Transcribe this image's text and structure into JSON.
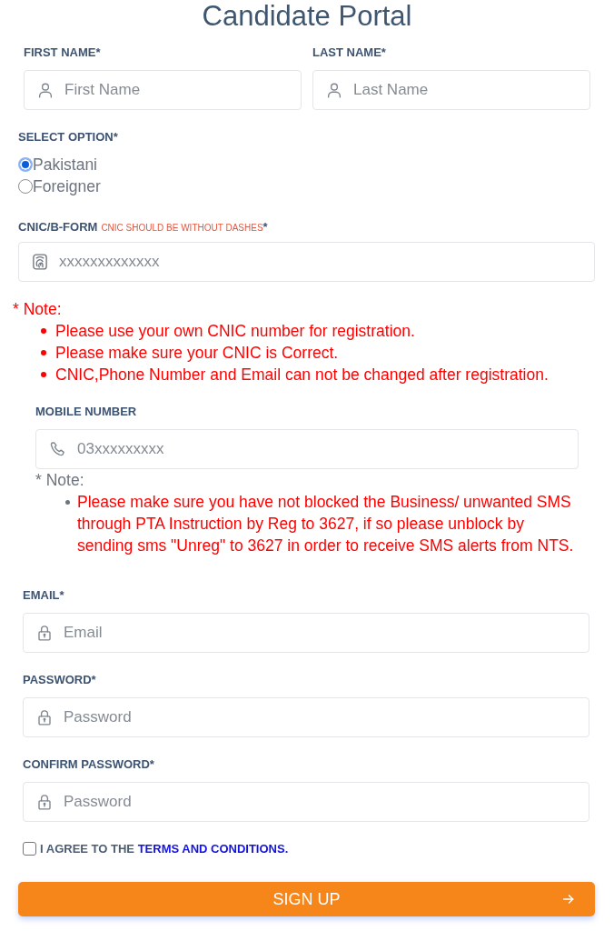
{
  "title": "Candidate Portal",
  "name_fields": [
    {
      "label": "FIRST NAME*",
      "placeholder": "First Name"
    },
    {
      "label": "LAST NAME*",
      "placeholder": "Last Name"
    }
  ],
  "select_option": {
    "label": "SELECT OPTION*",
    "options": [
      {
        "label": "Pakistani",
        "selected": true
      },
      {
        "label": "Foreigner",
        "selected": false
      }
    ]
  },
  "cnic": {
    "label": "CNIC/B-FORM",
    "hint": "CNIC SHOULD BE WITHOUT DASHES",
    "required_mark": "*",
    "placeholder": "xxxxxxxxxxxxx"
  },
  "cnic_note": {
    "heading": "* Note:",
    "items": [
      "Please use your own CNIC number for registration.",
      "Please make sure your CNIC is Correct.",
      "CNIC,Phone Number and Email can not be changed after registration."
    ]
  },
  "mobile": {
    "label": "MOBILE NUMBER",
    "placeholder": "03xxxxxxxxx"
  },
  "mobile_note": {
    "heading": "* Note:",
    "items": [
      "Please make sure you have not blocked the Business/ unwanted SMS through PTA Instruction by Reg to 3627, if so please unblock by sending sms \"Unreg\" to 3627 in order to receive SMS alerts from NTS."
    ]
  },
  "account_fields": [
    {
      "label": "EMAIL*",
      "placeholder": "Email"
    },
    {
      "label": "PASSWORD*",
      "placeholder": "Password"
    },
    {
      "label": "CONFIRM PASSWORD*",
      "placeholder": "Password"
    }
  ],
  "agreement": {
    "checked": false,
    "text": "I AGREE TO THE",
    "link": "TERMS AND CONDITIONS."
  },
  "submit": {
    "label": "SIGN UP"
  }
}
